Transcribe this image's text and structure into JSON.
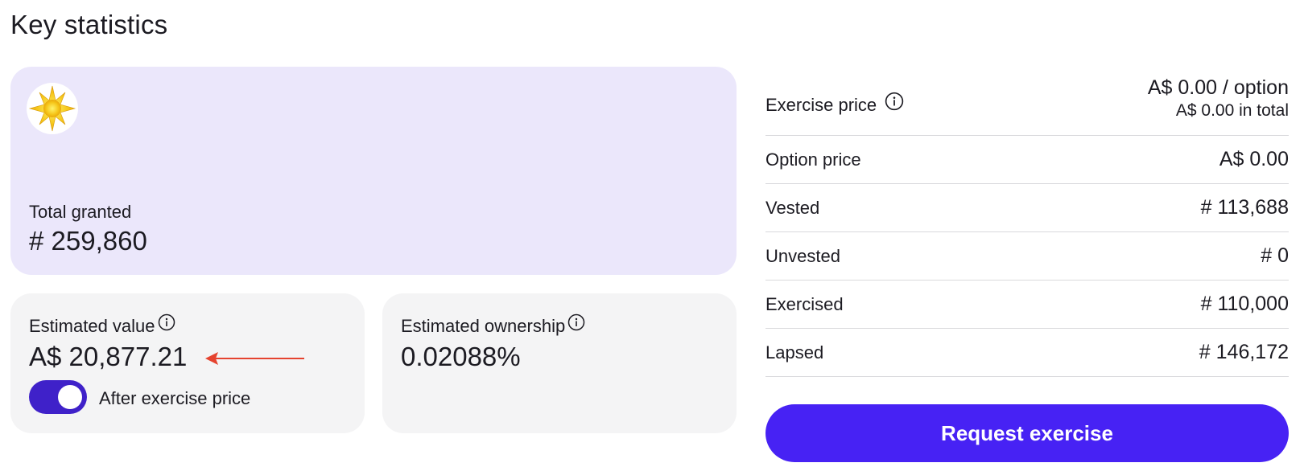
{
  "page_title": "Key statistics",
  "granted": {
    "label": "Total granted",
    "value": "# 259,860",
    "logo_icon": "sun-icon"
  },
  "estimated_value": {
    "label": "Estimated value",
    "value": "A$ 20,877.21",
    "toggle_label": "After exercise price",
    "toggle_on": true
  },
  "estimated_ownership": {
    "label": "Estimated ownership",
    "value": "0.02088%"
  },
  "stats": {
    "exercise_price": {
      "label": "Exercise price",
      "value": "A$ 0.00 / option",
      "sub": "A$ 0.00 in total"
    },
    "rows": [
      {
        "label": "Option price",
        "value": "A$ 0.00"
      },
      {
        "label": "Vested",
        "value": "# 113,688"
      },
      {
        "label": "Unvested",
        "value": "# 0"
      },
      {
        "label": "Exercised",
        "value": "# 110,000"
      },
      {
        "label": "Lapsed",
        "value": "# 146,172"
      }
    ]
  },
  "actions": {
    "request_exercise": "Request exercise"
  },
  "colors": {
    "accent": "#4722f4",
    "toggle": "#3f21c9",
    "granted_card": "#ebe7fb",
    "card": "#f4f4f5",
    "arrow": "#e5432f"
  }
}
